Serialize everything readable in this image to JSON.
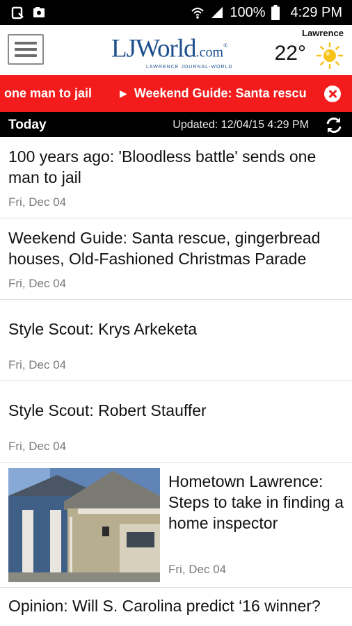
{
  "status_bar": {
    "battery": "100%",
    "time": "4:29 PM",
    "left_icons": [
      "notification-icon",
      "photo-icon"
    ],
    "right_icons": [
      "wifi-icon",
      "signal-icon",
      "battery-icon"
    ]
  },
  "header": {
    "menu_icon": "hamburger-icon",
    "logo_main": "LJWorld",
    "logo_suffix": ".com",
    "logo_sub": "LAWRENCE JOURNAL-WORLD",
    "weather": {
      "city": "Lawrence",
      "temperature": "22°",
      "icon": "sun-icon"
    }
  },
  "ticker": {
    "items": [
      "one man to jail",
      "Weekend Guide: Santa rescu"
    ],
    "close_icon": "close-circle-icon",
    "separator_icon": "play-icon",
    "color": "#f31b1b"
  },
  "section": {
    "title": "Today",
    "updated": "Updated: 12/04/15 4:29 PM",
    "refresh_icon": "refresh-icon"
  },
  "articles": [
    {
      "title": "100 years ago: 'Bloodless battle' sends one man to jail",
      "date": "Fri, Dec 04"
    },
    {
      "title": "Weekend Guide: Santa rescue, gingerbread houses, Old-Fashioned Christmas Parade",
      "date": "Fri, Dec 04"
    },
    {
      "title": "Style Scout: Krys Arkeketa",
      "date": "Fri, Dec 04"
    },
    {
      "title": "Style Scout: Robert Stauffer",
      "date": "Fri, Dec 04"
    },
    {
      "title": "Hometown Lawrence: Steps to take in finding a home inspector",
      "date": "Fri, Dec 04",
      "thumbnail": "house-photo"
    },
    {
      "title": "Opinion: Will S. Carolina predict ‘16 winner?"
    }
  ],
  "colors": {
    "brand_blue": "#1d4f8c",
    "alert_red": "#f31b1b",
    "sun_yellow": "#f7c21a"
  }
}
